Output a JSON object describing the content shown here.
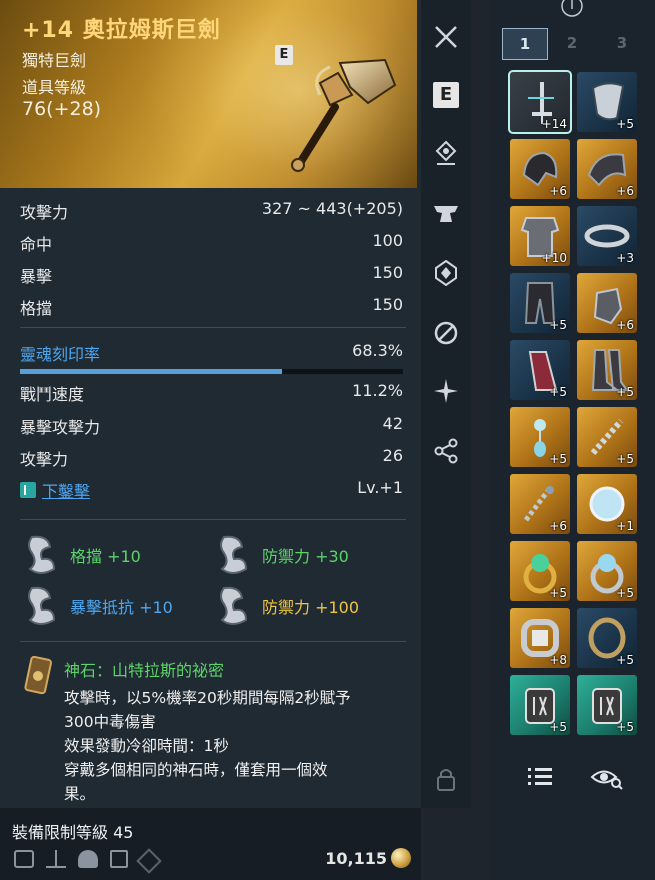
{
  "item": {
    "name": "+14 奧拉姆斯巨劍",
    "type": "獨特巨劍",
    "level_label": "道具等級",
    "level_value": "76(+28)",
    "grade": "E"
  },
  "base_stats": [
    {
      "label": "攻擊力",
      "value": "327 ~ 443(+205)"
    },
    {
      "label": "命中",
      "value": "100"
    },
    {
      "label": "暴擊",
      "value": "150"
    },
    {
      "label": "格擋",
      "value": "150"
    }
  ],
  "soul_engrave": {
    "label": "靈魂刻印率",
    "value": "68.3%",
    "percent": 68.3
  },
  "extra_stats": [
    {
      "label": "戰鬥速度",
      "value": "11.2%"
    },
    {
      "label": "暴擊攻擊力",
      "value": "42"
    },
    {
      "label": "攻擊力",
      "value": "26"
    }
  ],
  "skill": {
    "label": "下鑿擊",
    "value": "Lv.+1"
  },
  "runes": [
    {
      "label": "格擋 +10",
      "color": "#5dd36a"
    },
    {
      "label": "防禦力 +30",
      "color": "#5dd36a"
    },
    {
      "label": "暴擊抵抗 +10",
      "color": "#4da6f0"
    },
    {
      "label": "防禦力 +100",
      "color": "#f0c543"
    }
  ],
  "godstone": {
    "title": "神石：山特拉斯的祕密",
    "lines": [
      "攻擊時，以5%機率20秒期間每隔2秒賦予",
      "300中毒傷害",
      "效果發動冷卻時間：1秒",
      "穿戴多個相同的神石時，僅套用一個效",
      "果。"
    ]
  },
  "footer": {
    "requirement": "裝備限制等級 45",
    "price": "10,115"
  },
  "side_icons": [
    "close-icon",
    "enchant-icon",
    "location-icon",
    "anvil-icon",
    "soul-icon",
    "link-icon",
    "sparkle-icon",
    "share-icon",
    "lock-icon"
  ],
  "equipment_tabs": [
    "1",
    "2",
    "3"
  ],
  "equipment": [
    {
      "name": "greatsword",
      "level": "+14",
      "color": "selected"
    },
    {
      "name": "shield",
      "level": "+5",
      "color": "blue"
    },
    {
      "name": "helmet",
      "level": "+6",
      "color": "gold"
    },
    {
      "name": "shoulder",
      "level": "+6",
      "color": "gold"
    },
    {
      "name": "chest",
      "level": "+10",
      "color": "gold"
    },
    {
      "name": "belt",
      "level": "+3",
      "color": "blue"
    },
    {
      "name": "pants",
      "level": "+5",
      "color": "blue"
    },
    {
      "name": "gloves",
      "level": "+6",
      "color": "gold"
    },
    {
      "name": "cape",
      "level": "+5",
      "color": "blue"
    },
    {
      "name": "boots",
      "level": "+5",
      "color": "gold"
    },
    {
      "name": "earring-left",
      "level": "+5",
      "color": "gold"
    },
    {
      "name": "earring-right",
      "level": "+5",
      "color": "gold"
    },
    {
      "name": "necklace",
      "level": "+6",
      "color": "gold"
    },
    {
      "name": "orb",
      "level": "+1",
      "color": "gold"
    },
    {
      "name": "ring-left",
      "level": "+5",
      "color": "gold"
    },
    {
      "name": "ring-right",
      "level": "+5",
      "color": "gold"
    },
    {
      "name": "bracelet-left",
      "level": "+8",
      "color": "gold"
    },
    {
      "name": "bracelet-right",
      "level": "+5",
      "color": "blue"
    },
    {
      "name": "rune-stone-left",
      "level": "+5",
      "color": "teal"
    },
    {
      "name": "rune-stone-right",
      "level": "+5",
      "color": "teal"
    }
  ]
}
